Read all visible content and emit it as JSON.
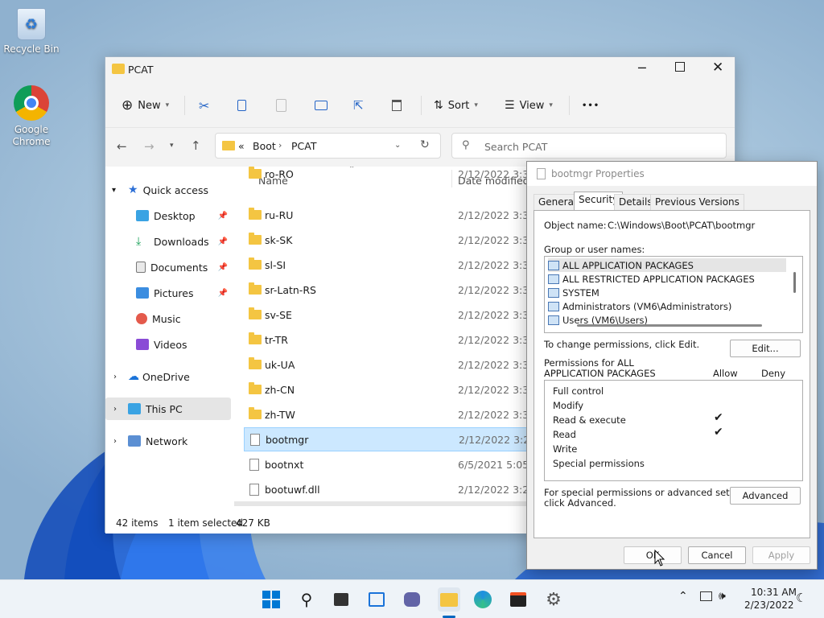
{
  "desktop": {
    "icons": [
      {
        "label": "Recycle Bin"
      },
      {
        "label": "Google Chrome"
      }
    ]
  },
  "explorer": {
    "title": "PCAT",
    "toolbar": {
      "new": "New",
      "sort": "Sort",
      "view": "View",
      "more": "•••"
    },
    "address": {
      "overflow": "«",
      "crumbs": [
        "Boot",
        "PCAT"
      ],
      "search_placeholder": "Search PCAT"
    },
    "columns": {
      "name": "Name",
      "date": "Date modified"
    },
    "nav": {
      "quick_access": "Quick access",
      "items": [
        "Desktop",
        "Downloads",
        "Documents",
        "Pictures",
        "Music",
        "Videos"
      ],
      "onedrive": "OneDrive",
      "thispc": "This PC",
      "network": "Network"
    },
    "files": [
      {
        "name": "ro-RO",
        "date": "2/12/2022 3:30 P",
        "type": "folder"
      },
      {
        "name": "ru-RU",
        "date": "2/12/2022 3:30 P",
        "type": "folder"
      },
      {
        "name": "sk-SK",
        "date": "2/12/2022 3:30 P",
        "type": "folder"
      },
      {
        "name": "sl-SI",
        "date": "2/12/2022 3:30 P",
        "type": "folder"
      },
      {
        "name": "sr-Latn-RS",
        "date": "2/12/2022 3:30 P",
        "type": "folder"
      },
      {
        "name": "sv-SE",
        "date": "2/12/2022 3:30 P",
        "type": "folder"
      },
      {
        "name": "tr-TR",
        "date": "2/12/2022 3:30 P",
        "type": "folder"
      },
      {
        "name": "uk-UA",
        "date": "2/12/2022 3:30 P",
        "type": "folder"
      },
      {
        "name": "zh-CN",
        "date": "2/12/2022 3:30 P",
        "type": "folder"
      },
      {
        "name": "zh-TW",
        "date": "2/12/2022 3:30 P",
        "type": "folder"
      },
      {
        "name": "bootmgr",
        "date": "2/12/2022 3:24 P",
        "type": "file",
        "selected": true
      },
      {
        "name": "bootnxt",
        "date": "6/5/2021 5:05 AM",
        "type": "file"
      },
      {
        "name": "bootuwf.dll",
        "date": "2/12/2022 3:24 P",
        "type": "file"
      }
    ],
    "status": {
      "items": "42 items",
      "selected": "1 item selected",
      "size": "427 KB"
    }
  },
  "props": {
    "title": "bootmgr Properties",
    "tabs": [
      "General",
      "Security",
      "Details",
      "Previous Versions"
    ],
    "object_label": "Object name:",
    "object_value": "C:\\Windows\\Boot\\PCAT\\bootmgr",
    "group_label": "Group or user names:",
    "users": [
      "ALL APPLICATION PACKAGES",
      "ALL RESTRICTED APPLICATION PACKAGES",
      "SYSTEM",
      "Administrators (VM6\\Administrators)",
      "Users (VM6\\Users)"
    ],
    "change_text": "To change permissions, click Edit.",
    "edit_btn": "Edit...",
    "perm_title_1": "Permissions for ALL",
    "perm_title_2": "APPLICATION PACKAGES",
    "allow": "Allow",
    "deny": "Deny",
    "permissions": [
      {
        "name": "Full control",
        "allow": false
      },
      {
        "name": "Modify",
        "allow": false
      },
      {
        "name": "Read & execute",
        "allow": true
      },
      {
        "name": "Read",
        "allow": true
      },
      {
        "name": "Write",
        "allow": false
      },
      {
        "name": "Special permissions",
        "allow": false
      }
    ],
    "check_glyph": "✔",
    "special_1": "For special permissions or advanced settings,",
    "special_2": "click Advanced.",
    "advanced_btn": "Advanced",
    "ok": "OK",
    "cancel": "Cancel",
    "apply": "Apply"
  },
  "taskbar": {
    "time": "10:31 AM",
    "date": "2/23/2022"
  }
}
